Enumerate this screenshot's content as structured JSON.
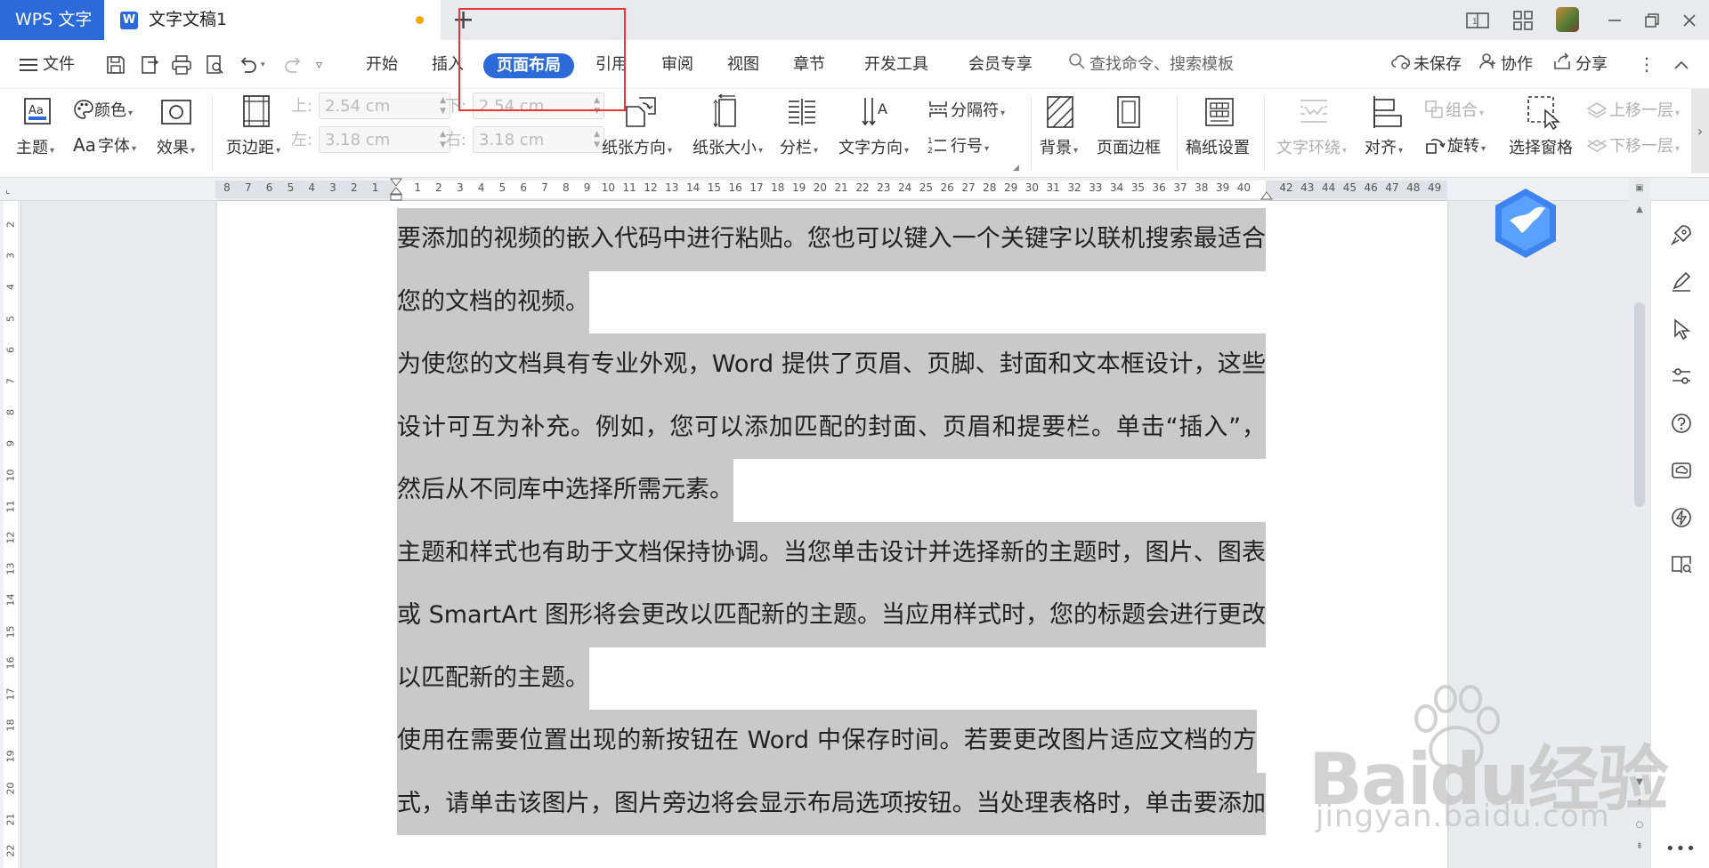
{
  "app": {
    "name": "WPS 文字",
    "doc_title": "文字文稿1"
  },
  "menu": {
    "file": "文件",
    "tabs": [
      "开始",
      "插入",
      "页面布局",
      "引用",
      "审阅",
      "视图",
      "章节",
      "开发工具",
      "会员专享"
    ],
    "active_tab": "页面布局",
    "search_placeholder": "查找命令、搜索模板",
    "unsaved": "未保存",
    "collab": "协作",
    "share": "分享"
  },
  "ribbon": {
    "theme": "主题",
    "colors": "颜色",
    "fonts": "字体",
    "effects": "效果",
    "margins": "页边距",
    "margin_top_label": "上:",
    "margin_top": "2.54 cm",
    "margin_bottom_label": "下:",
    "margin_bottom": "2.54 cm",
    "margin_left_label": "左:",
    "margin_left": "3.18 cm",
    "margin_right_label": "右:",
    "margin_right": "3.18 cm",
    "orientation": "纸张方向",
    "size": "纸张大小",
    "columns": "分栏",
    "text_direction": "文字方向",
    "breaks": "分隔符",
    "line_numbers": "行号",
    "background": "背景",
    "page_border": "页面边框",
    "paper_setup": "稿纸设置",
    "text_wrap": "文字环绕",
    "align": "对齐",
    "group": "组合",
    "rotate": "旋转",
    "selection_pane": "选择窗格",
    "bring_forward": "上移一层",
    "send_backward": "下移一层"
  },
  "ruler": {
    "marks": [
      "8",
      "7",
      "6",
      "5",
      "4",
      "3",
      "2",
      "1",
      "",
      "1",
      "2",
      "3",
      "4",
      "5",
      "6",
      "7",
      "8",
      "9",
      "10",
      "11",
      "12",
      "13",
      "14",
      "15",
      "16",
      "17",
      "18",
      "19",
      "20",
      "21",
      "22",
      "23",
      "24",
      "25",
      "26",
      "27",
      "28",
      "29",
      "30",
      "31",
      "32",
      "33",
      "34",
      "35",
      "36",
      "37",
      "38",
      "39",
      "40",
      "",
      "42",
      "43",
      "44",
      "45",
      "46",
      "47",
      "48",
      "49"
    ],
    "vmarks": [
      "2",
      "3",
      "4",
      "5",
      "6",
      "7",
      "8",
      "9",
      "10",
      "11",
      "12",
      "13",
      "14",
      "15",
      "16",
      "17",
      "18",
      "19",
      "20",
      "21",
      "22"
    ]
  },
  "document": {
    "lines": [
      "要添加的视频的嵌入代码中进行粘贴。您也可以键入一个关键字以联机搜索最适合",
      "您的文档的视频。",
      "为使您的文档具有专业外观，Word 提供了页眉、页脚、封面和文本框设计，这些",
      "设计可互为补充。例如，您可以添加匹配的封面、页眉和提要栏。单击“插入”，",
      "然后从不同库中选择所需元素。",
      "主题和样式也有助于文档保持协调。当您单击设计并选择新的主题时，图片、图表",
      "或 SmartArt 图形将会更改以匹配新的主题。当应用样式时，您的标题会进行更改",
      "以匹配新的主题。",
      "使用在需要位置出现的新按钮在 Word 中保存时间。若要更改图片适应文档的方",
      "式，请单击该图片，图片旁边将会显示布局选项按钮。当处理表格时，单击要添加"
    ]
  },
  "watermark": {
    "brand": "Baidu经验",
    "url": "jingyan.baidu.com"
  },
  "colors": {
    "accent": "#2b6ad8",
    "highlight": "#c9c9c9",
    "annotation": "#e8363a"
  }
}
